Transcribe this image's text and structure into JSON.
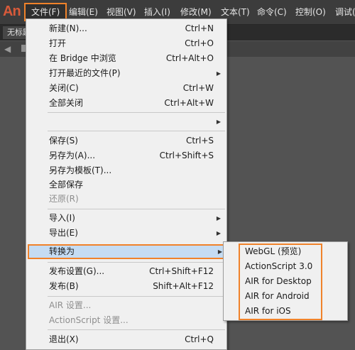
{
  "app": {
    "logo_text": "An"
  },
  "menubar": {
    "items": [
      {
        "label": "文件(F)"
      },
      {
        "label": "编辑(E)"
      },
      {
        "label": "视图(V)"
      },
      {
        "label": "插入(I)"
      },
      {
        "label": "修改(M)"
      },
      {
        "label": "文本(T)"
      },
      {
        "label": "命令(C)"
      },
      {
        "label": "控制(O)"
      },
      {
        "label": "调试("
      }
    ]
  },
  "tabstrip": {
    "doc_tab_label": "无标题"
  },
  "file_menu": {
    "items": [
      {
        "label": "新建(N)...",
        "shortcut": "Ctrl+N"
      },
      {
        "label": "打开",
        "shortcut": "Ctrl+O"
      },
      {
        "label": "在 Bridge 中浏览",
        "shortcut": "Ctrl+Alt+O"
      },
      {
        "label": "打开最近的文件(P)",
        "shortcut": ""
      },
      {
        "label": "关闭(C)",
        "shortcut": "Ctrl+W"
      },
      {
        "label": "全部关闭",
        "shortcut": "Ctrl+Alt+W"
      },
      {
        "label": "",
        "shortcut": ""
      },
      {
        "label": "保存(S)",
        "shortcut": "Ctrl+S"
      },
      {
        "label": "另存为(A)...",
        "shortcut": "Ctrl+Shift+S"
      },
      {
        "label": "另存为模板(T)...",
        "shortcut": ""
      },
      {
        "label": "全部保存",
        "shortcut": ""
      },
      {
        "label": "还原(R)",
        "shortcut": ""
      },
      {
        "label": "导入(I)",
        "shortcut": ""
      },
      {
        "label": "导出(E)",
        "shortcut": ""
      },
      {
        "label": "转换为",
        "shortcut": ""
      },
      {
        "label": "发布设置(G)...",
        "shortcut": "Ctrl+Shift+F12"
      },
      {
        "label": "发布(B)",
        "shortcut": "Shift+Alt+F12"
      },
      {
        "label": "AIR 设置...",
        "shortcut": ""
      },
      {
        "label": "ActionScript 设置...",
        "shortcut": ""
      },
      {
        "label": "退出(X)",
        "shortcut": "Ctrl+Q"
      }
    ]
  },
  "convert_submenu": {
    "items": [
      {
        "label": "WebGL (预览)"
      },
      {
        "label": "ActionScript 3.0"
      },
      {
        "label": "AIR for Desktop"
      },
      {
        "label": "AIR for Android"
      },
      {
        "label": "AIR for iOS"
      }
    ]
  },
  "colors": {
    "highlight_border": "#f0822a",
    "highlight_fill": "#c5dcf3",
    "logo": "#d85a3a",
    "menubar_bg": "#3c3c3c"
  }
}
